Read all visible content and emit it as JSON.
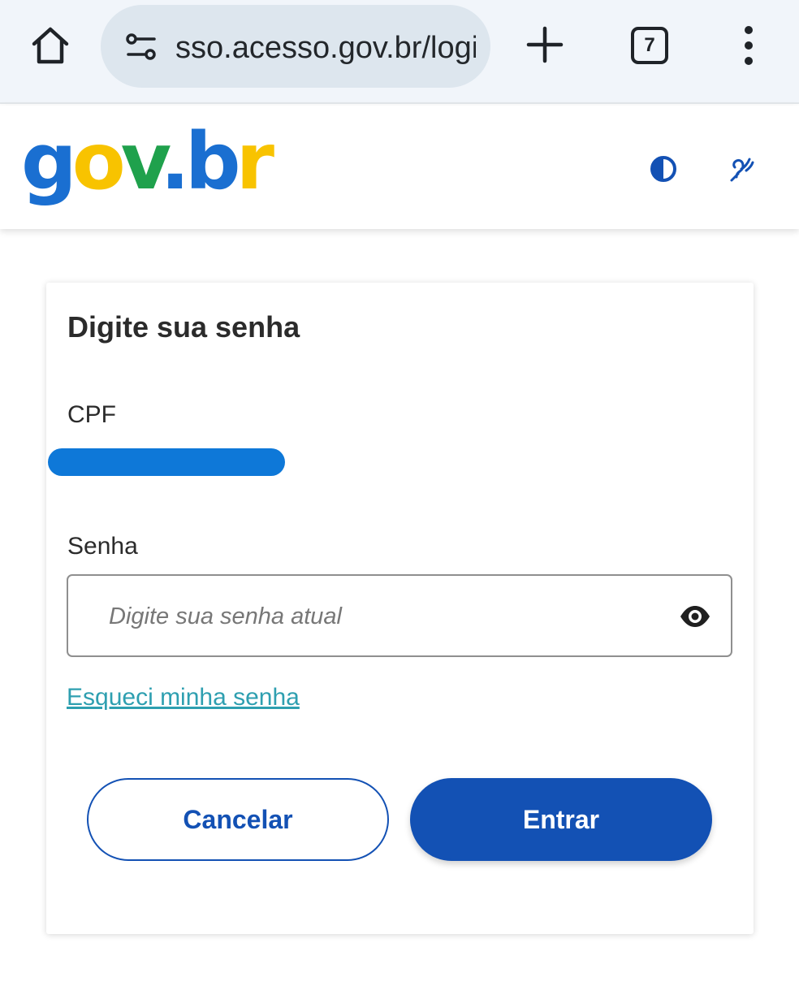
{
  "browser": {
    "url": "sso.acesso.gov.br/login",
    "tab_count": "7",
    "icons": [
      "home-icon",
      "tune-icon",
      "plus-icon",
      "tabs-icon",
      "more-vert-icon"
    ]
  },
  "header": {
    "logo_text": {
      "g": "g",
      "o": "o",
      "v": "v",
      "dot": ".",
      "b": "b",
      "r": "r"
    },
    "icons": [
      "contrast-icon",
      "sign-language-icon"
    ],
    "colors": {
      "blue": "#1a6fd1",
      "yellow": "#f8c300",
      "green": "#1fa14c"
    }
  },
  "form": {
    "title": "Digite sua senha",
    "cpf_label": "CPF",
    "password_label": "Senha",
    "password_placeholder": "Digite sua senha atual",
    "forgot_link": "Esqueci minha senha",
    "cancel_button": "Cancelar",
    "enter_button": "Entrar",
    "colors": {
      "primary": "#1351b4",
      "link": "#2e9fb0"
    }
  }
}
